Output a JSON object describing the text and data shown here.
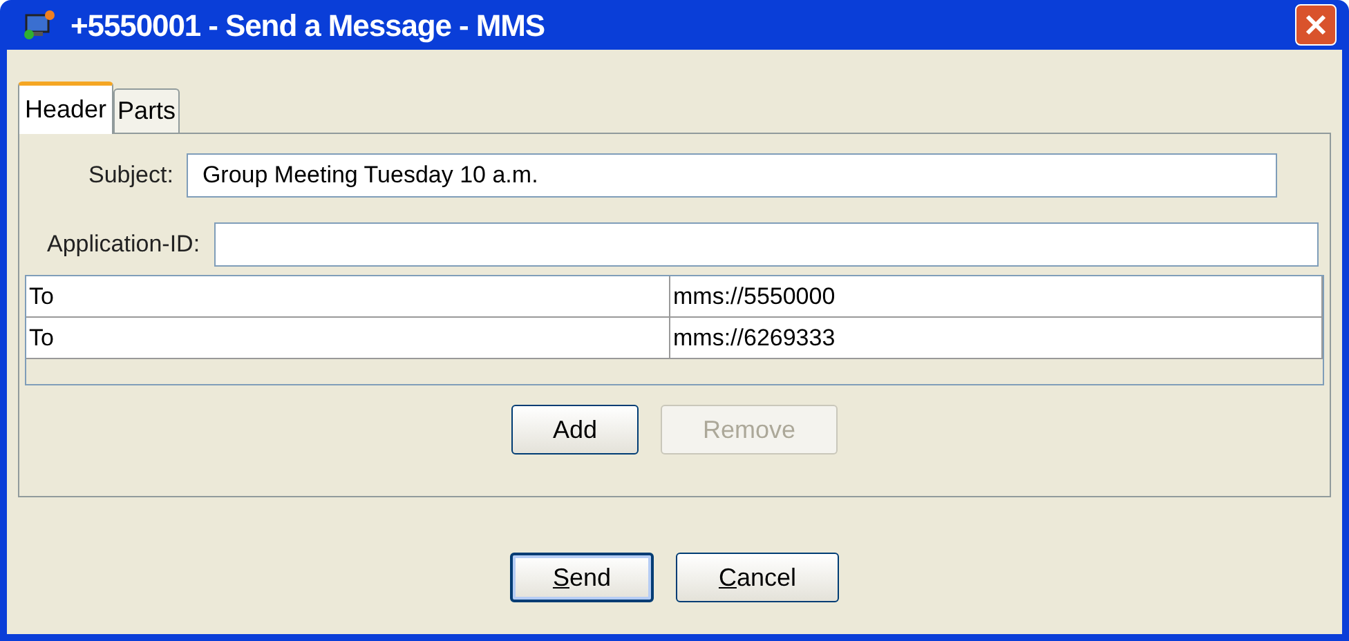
{
  "window": {
    "title": "+5550001 - Send a Message - MMS"
  },
  "tabs": [
    {
      "label": "Header",
      "selected": true
    },
    {
      "label": "Parts",
      "selected": false
    }
  ],
  "fields": [
    {
      "label": "Subject:",
      "value": "Group Meeting Tuesday 10 a.m."
    },
    {
      "label": "Application-ID:"
    }
  ],
  "recipients": [
    {
      "type": "To",
      "address": "mms://5550000"
    },
    {
      "type": "To",
      "address": "mms://6269333"
    }
  ],
  "table_buttons": [
    {
      "label": "Add",
      "disabled": false,
      "default": false
    },
    {
      "label": "Remove",
      "disabled": true,
      "default": false
    }
  ],
  "dialog_buttons": [
    {
      "label": "Send",
      "disabled": false,
      "default": true,
      "mnemonic_first": true
    },
    {
      "label": "Cancel",
      "disabled": false,
      "default": false,
      "mnemonic_first": true
    }
  ]
}
